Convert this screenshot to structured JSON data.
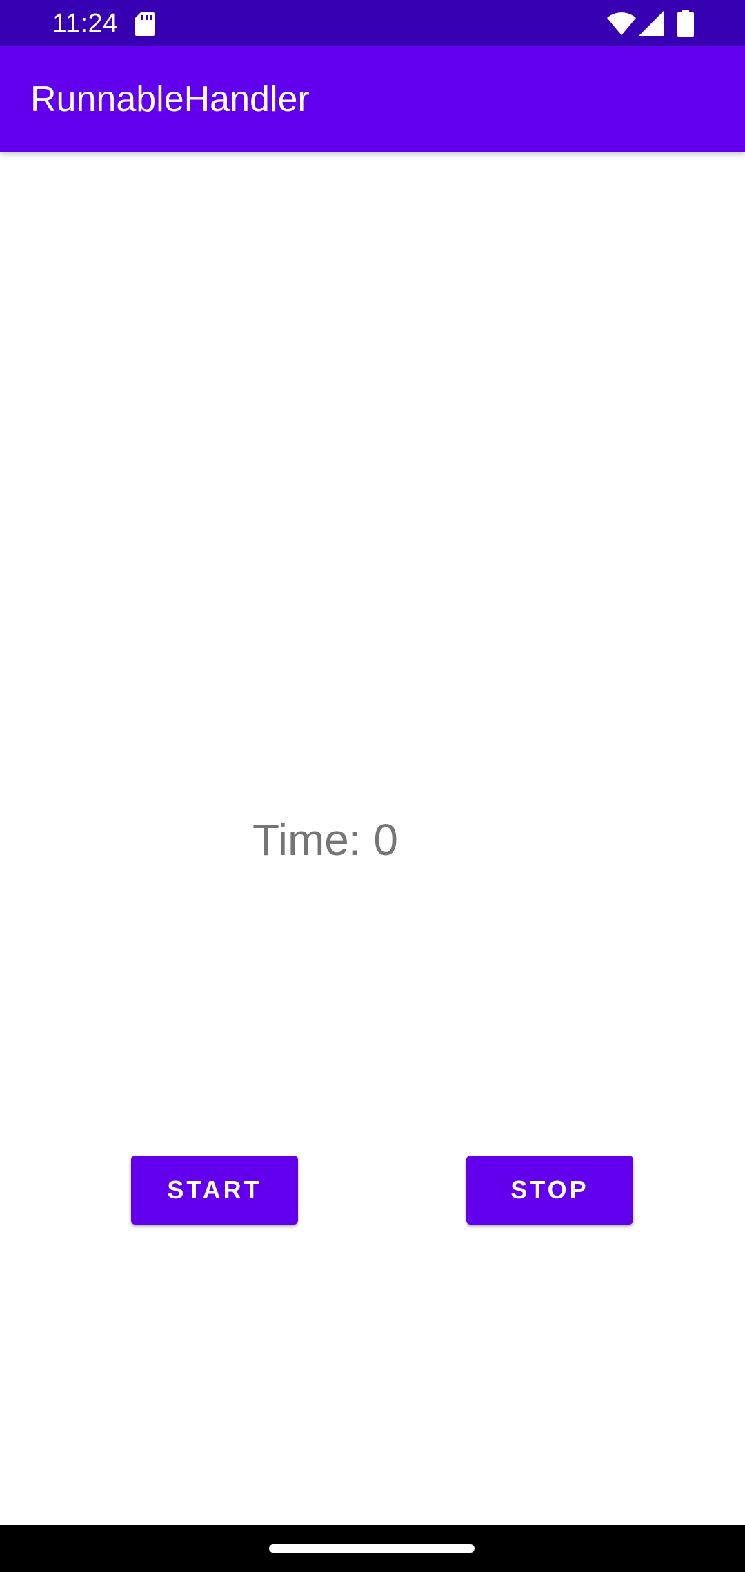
{
  "status_bar": {
    "time": "11:24",
    "icons": [
      "sd-card-icon",
      "wifi-icon",
      "signal-icon",
      "battery-icon"
    ],
    "background": "#3700B3"
  },
  "app_bar": {
    "title": "RunnableHandler",
    "background": "#6200EE"
  },
  "main": {
    "time_label": "Time: 0",
    "start_button": "START",
    "stop_button": "STOP",
    "button_color": "#6200EE",
    "text_color": "#757575"
  },
  "nav_bar": {
    "handle": "home-gesture-handle"
  }
}
